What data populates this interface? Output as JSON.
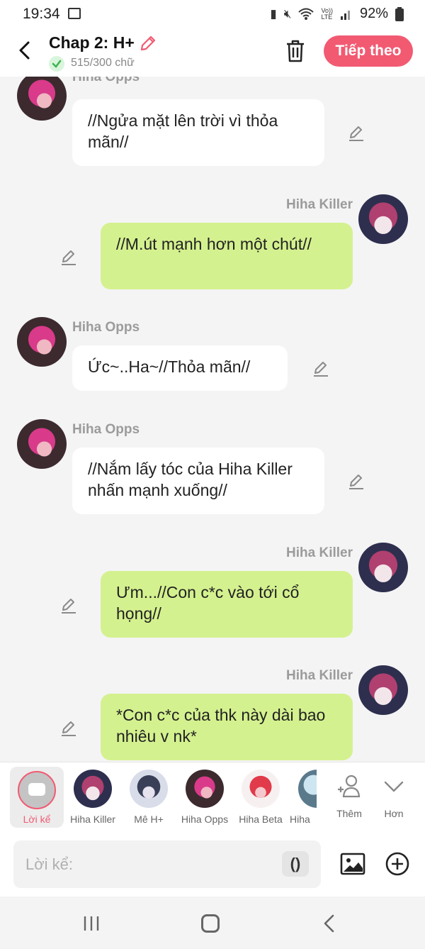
{
  "status": {
    "time": "19:34",
    "lte_top": "Vo))",
    "lte_bottom": "LTE",
    "battery": "92%"
  },
  "header": {
    "title": "Chap 2: H+",
    "word_count": "515/300 chữ",
    "next_label": "Tiếp theo"
  },
  "messages": [
    {
      "sender": "Hiha Opps",
      "side": "left",
      "text": "//Ngửa mặt lên trời vì thỏa mãn//"
    },
    {
      "sender": "Hiha Killer",
      "side": "right",
      "text": "//M.út mạnh hơn một chút//"
    },
    {
      "sender": "Hiha Opps",
      "side": "left",
      "text": "Ức~..Ha~//Thỏa mãn//"
    },
    {
      "sender": "Hiha Opps",
      "side": "left",
      "text": "//Nắm lấy tóc của Hiha Killer nhấn mạnh xuống//"
    },
    {
      "sender": "Hiha Killer",
      "side": "right",
      "text": "Ưm...//Con c*c vào tới cổ họng//"
    },
    {
      "sender": "Hiha Killer",
      "side": "right",
      "text": "*Con c*c của thk này dài bao nhiêu v nk*"
    }
  ],
  "characters": [
    {
      "label": "Lời kể",
      "selected": true
    },
    {
      "label": "Hiha Killer"
    },
    {
      "label": "Mê H+"
    },
    {
      "label": "Hiha Opps"
    },
    {
      "label": "Hiha Beta"
    },
    {
      "label": "Hiha"
    }
  ],
  "actions": {
    "add_label": "Thêm",
    "more_label": "Hơn"
  },
  "composer": {
    "placeholder": "Lời kể:",
    "paren_label": "()"
  },
  "colors": {
    "accent": "#f25a72",
    "bubble_green": "#d4f18f",
    "bubble_white": "#ffffff"
  },
  "icons": [
    "back-icon",
    "pencil-icon",
    "check-icon",
    "trash-icon",
    "add-person-icon",
    "chevron-down-icon",
    "image-icon",
    "plus-circle-icon"
  ]
}
